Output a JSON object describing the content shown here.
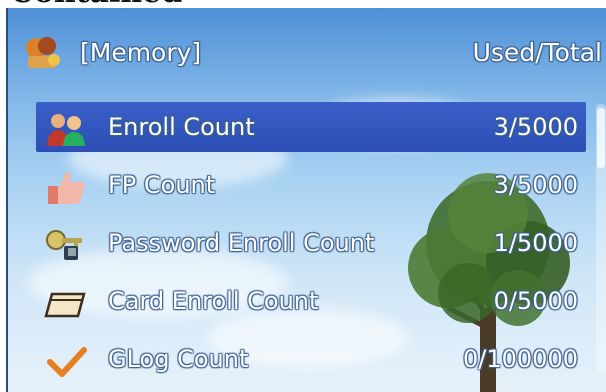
{
  "caption": "Contained",
  "header": {
    "title": "[Memory]",
    "right": "Used/Total",
    "icon": "memory-icon"
  },
  "items": [
    {
      "label": "Enroll Count",
      "value": "3/5000",
      "icon": "users-icon",
      "selected": true
    },
    {
      "label": "FP Count",
      "value": "3/5000",
      "icon": "thumb-icon",
      "selected": false
    },
    {
      "label": "Password Enroll Count",
      "value": "1/5000",
      "icon": "key-icon",
      "selected": false
    },
    {
      "label": "Card Enroll Count",
      "value": "0/5000",
      "icon": "card-icon",
      "selected": false
    },
    {
      "label": "GLog Count",
      "value": "0/100000",
      "icon": "check-icon",
      "selected": false
    }
  ],
  "colors": {
    "selection": "#2d4fb5",
    "sky_top": "#4f8fd6",
    "sky_bottom": "#e7f2fb"
  }
}
